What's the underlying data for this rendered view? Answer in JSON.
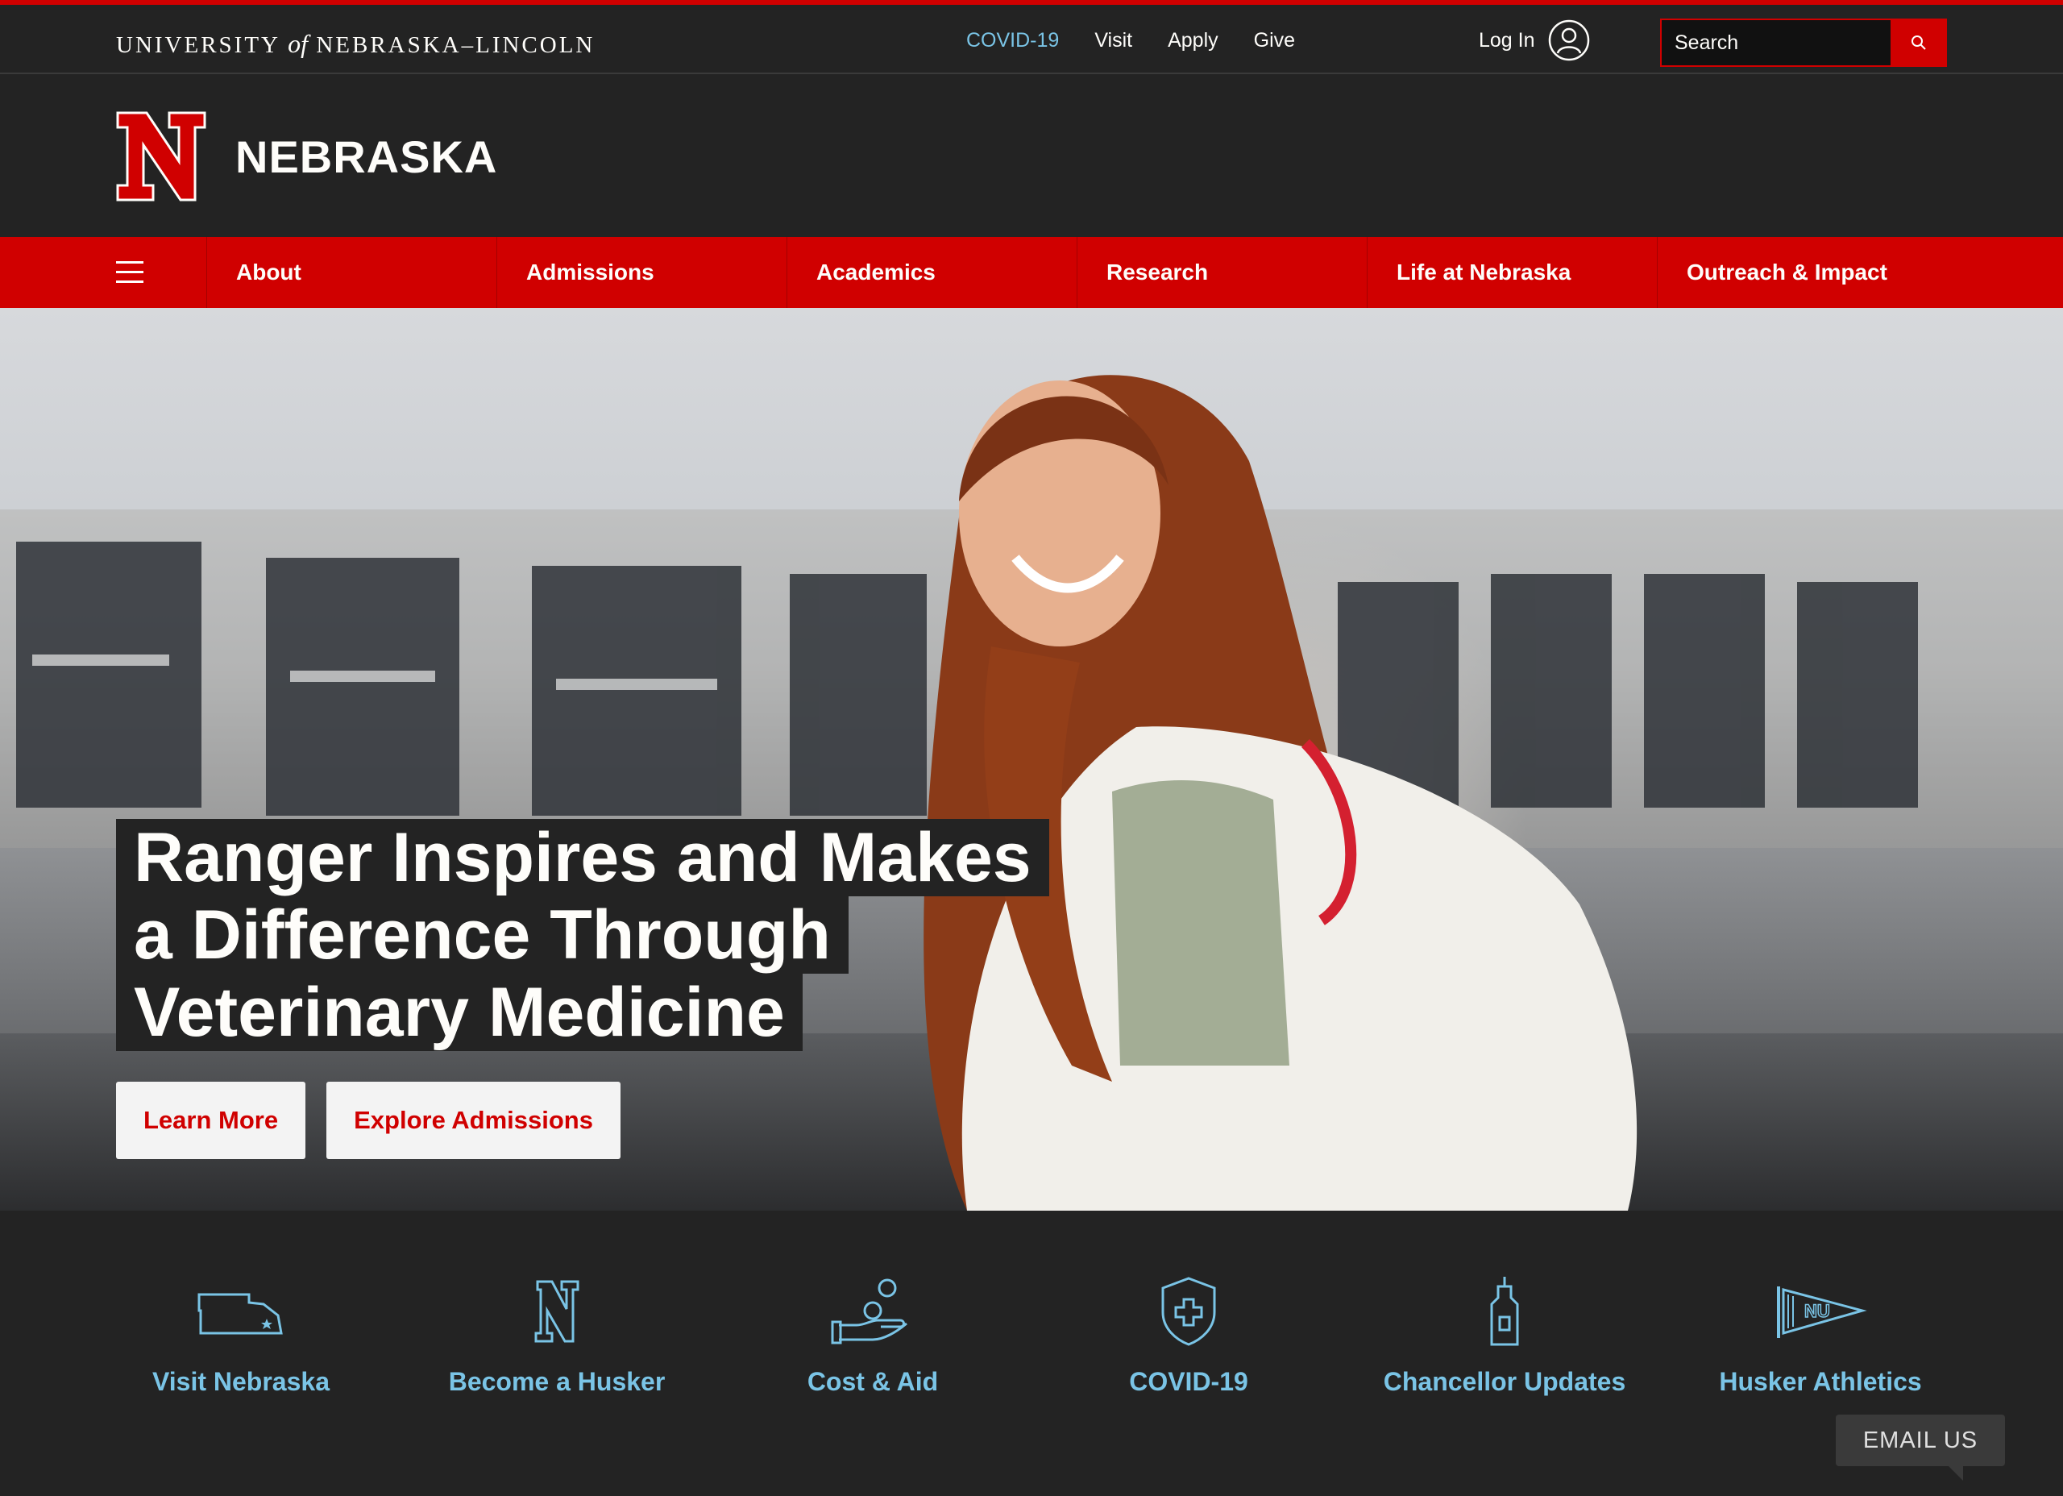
{
  "utility": {
    "wordmark_pre": "UNIVERSITY ",
    "wordmark_of": "of",
    "wordmark_post": " NEBRASKA–LINCOLN",
    "links": [
      {
        "label": "COVID-19"
      },
      {
        "label": "Visit"
      },
      {
        "label": "Apply"
      },
      {
        "label": "Give"
      }
    ],
    "login_label": "Log In",
    "search_placeholder": "Search"
  },
  "brand": {
    "name": "NEBRASKA"
  },
  "nav": {
    "items": [
      {
        "label": "About"
      },
      {
        "label": "Admissions"
      },
      {
        "label": "Academics"
      },
      {
        "label": "Research"
      },
      {
        "label": "Life at Nebraska"
      },
      {
        "label": "Outreach & Impact"
      }
    ]
  },
  "hero": {
    "headline_lines": [
      "Ranger Inspires and Makes",
      "a Difference Through",
      "Veterinary Medicine"
    ],
    "cta_primary": "Learn More",
    "cta_secondary": "Explore Admissions"
  },
  "quicklinks": [
    {
      "label": "Visit Nebraska",
      "icon": "nebraska-map-icon"
    },
    {
      "label": "Become a Husker",
      "icon": "n-logo-icon"
    },
    {
      "label": "Cost & Aid",
      "icon": "hand-coin-icon"
    },
    {
      "label": "COVID-19",
      "icon": "shield-cross-icon"
    },
    {
      "label": "Chancellor Updates",
      "icon": "tower-icon"
    },
    {
      "label": "Husker Athletics",
      "icon": "pennant-icon"
    }
  ],
  "email_us": "EMAIL US",
  "colors": {
    "brand_red": "#d00000",
    "dark": "#232323",
    "link_blue": "#7ac4e6"
  }
}
